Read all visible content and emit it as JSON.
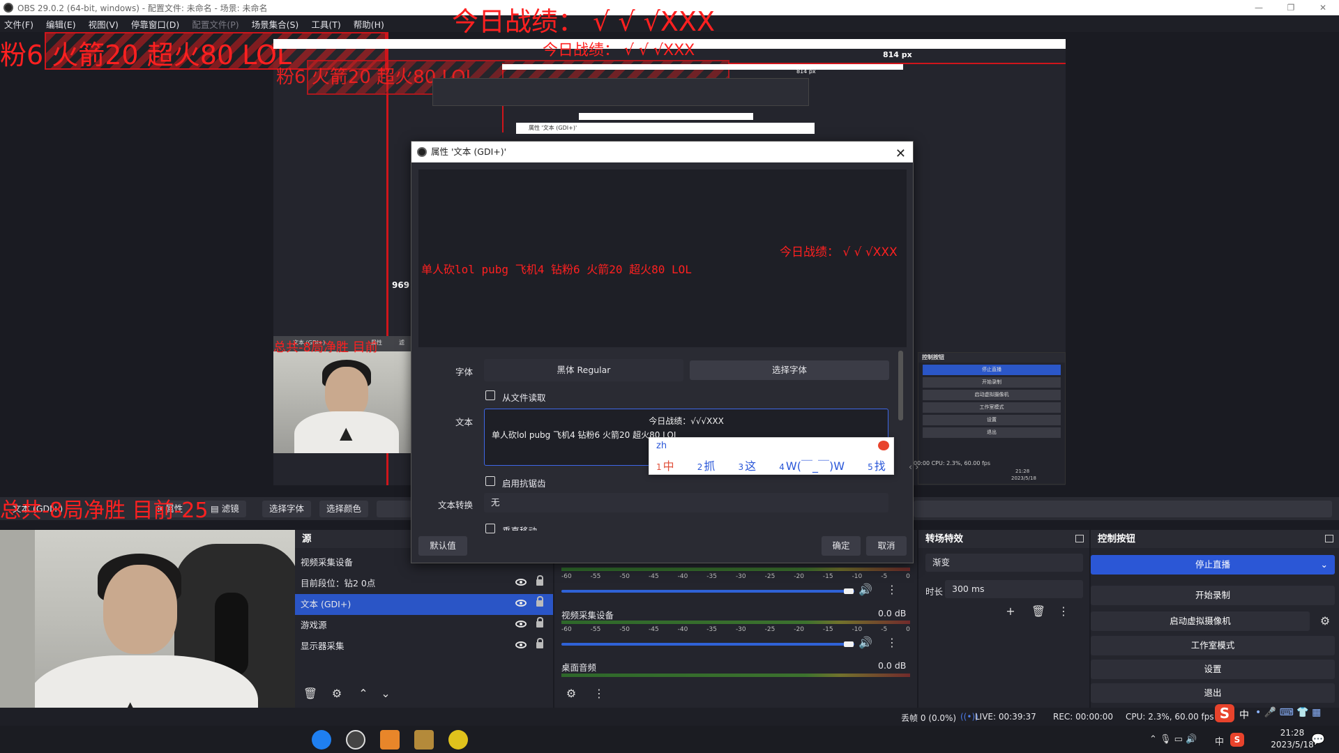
{
  "window": {
    "title": "OBS 29.0.2 (64-bit, windows) - 配置文件: 未命名 - 场景: 未命名",
    "controls": [
      "—",
      "❐",
      "✕"
    ]
  },
  "menu": [
    "文件(F)",
    "编辑(E)",
    "视图(V)",
    "停靠窗口(D)",
    "配置文件(P)",
    "场景集合(S)",
    "工具(T)",
    "帮助(H)"
  ],
  "preview": {
    "overlay_title": "今日战绩： √ √ √XXX",
    "overlay_line": "粉6 火箭20 超火80 LOL",
    "nested_overlay_title": "今日战绩： √ √ √XXX",
    "nested_overlay_line": "粉6 火箭20 超火80 LOL",
    "px_label": "814 px",
    "px_label_small": "814 px",
    "height_label": "969",
    "cam_overlay": "总共-8局净胜 目前-25",
    "cam_overlay_small": "总共-8局净胜 目前",
    "mini_src_label": "文本 (GDI+)",
    "mini_prop_label": "属性",
    "mini_filter_label": "滤",
    "mini_dialog_title": "属性 '文本 (GDI+)'",
    "mini_controls": {
      "header": "控制按钮",
      "buttons": [
        "停止直播",
        "开始录制",
        "启动虚拟摄像机",
        "工作室模式",
        "设置",
        "退出"
      ],
      "status": "00:00    CPU: 2.3%, 60.00 fps",
      "clock_time": "21:28",
      "clock_date": "2023/5/18"
    }
  },
  "source_toolbar": {
    "source_name": "文本 (GDI+)",
    "properties": "属性",
    "filters": "滤镜",
    "select_font": "选择字体",
    "select_color": "选择颜色",
    "cam_overlay": "总共-8局净胜 目前-25"
  },
  "sources_dock": {
    "title": "源",
    "items": [
      {
        "name": "视频采集设备",
        "selected": false
      },
      {
        "name": "目前段位：钻2 0点",
        "selected": false
      },
      {
        "name": "文本 (GDI+)",
        "selected": true
      },
      {
        "name": "游戏源",
        "selected": false
      },
      {
        "name": "显示器采集",
        "selected": false
      }
    ]
  },
  "mixer": {
    "ticks": [
      "-60",
      "-55",
      "-50",
      "-45",
      "-40",
      "-35",
      "-30",
      "-25",
      "-20",
      "-15",
      "-10",
      "-5",
      "0"
    ],
    "channels": [
      {
        "name": "视频采集设备",
        "db": "0.0 dB"
      },
      {
        "name": "桌面音频",
        "db": "0.0 dB"
      }
    ]
  },
  "transitions": {
    "title": "转场特效",
    "transition": "渐变",
    "duration_label": "时长",
    "duration": "300 ms"
  },
  "controls": {
    "title": "控制按钮",
    "stop_stream": "停止直播",
    "start_record": "开始录制",
    "virtual_cam": "启动虚拟摄像机",
    "studio_mode": "工作室模式",
    "settings": "设置",
    "exit": "退出"
  },
  "status": {
    "dropped": "丢帧 0 (0.0%)",
    "live": "LIVE: 00:39:37",
    "rec": "REC: 00:00:00",
    "cpu": "CPU: 2.3%, 60.00 fps"
  },
  "taskbar": {
    "time": "21:28",
    "date": "2023/5/18",
    "ime_lang": "中",
    "tray_lang": "中"
  },
  "dialog": {
    "title": "属性 '文本 (GDI+)'",
    "preview_title": "今日战绩： √ √ √XXX",
    "preview_line": "单人砍lol pubg 飞机4 钻粉6 火箭20 超火80 LOL",
    "font_label": "字体",
    "font_value": "黑体 Regular",
    "select_font_button": "选择字体",
    "read_from_file": "从文件读取",
    "text_label": "文本",
    "text_line1": "今日战绩：√√√XXX",
    "text_line2": "单人砍lol pubg 飞机4 钻粉6 火箭20 超火80 LOL",
    "antialias": "启用抗锯齿",
    "transform_label": "文本转换",
    "transform_value": "无",
    "vertical": "垂直移动",
    "defaults_button": "默认值",
    "ok_button": "确定",
    "cancel_button": "取消"
  },
  "ime": {
    "input": "zh",
    "candidates": [
      {
        "num": "1",
        "text": "中"
      },
      {
        "num": "2",
        "text": "抓"
      },
      {
        "num": "3",
        "text": "这"
      },
      {
        "num": "4",
        "text": "W(￣_￣)W"
      },
      {
        "num": "5",
        "text": "找"
      }
    ],
    "nav": "‹ ›"
  },
  "colors": {
    "accent": "#2b57d6",
    "overlay_red": "#ff2020",
    "panel": "#24252d"
  }
}
